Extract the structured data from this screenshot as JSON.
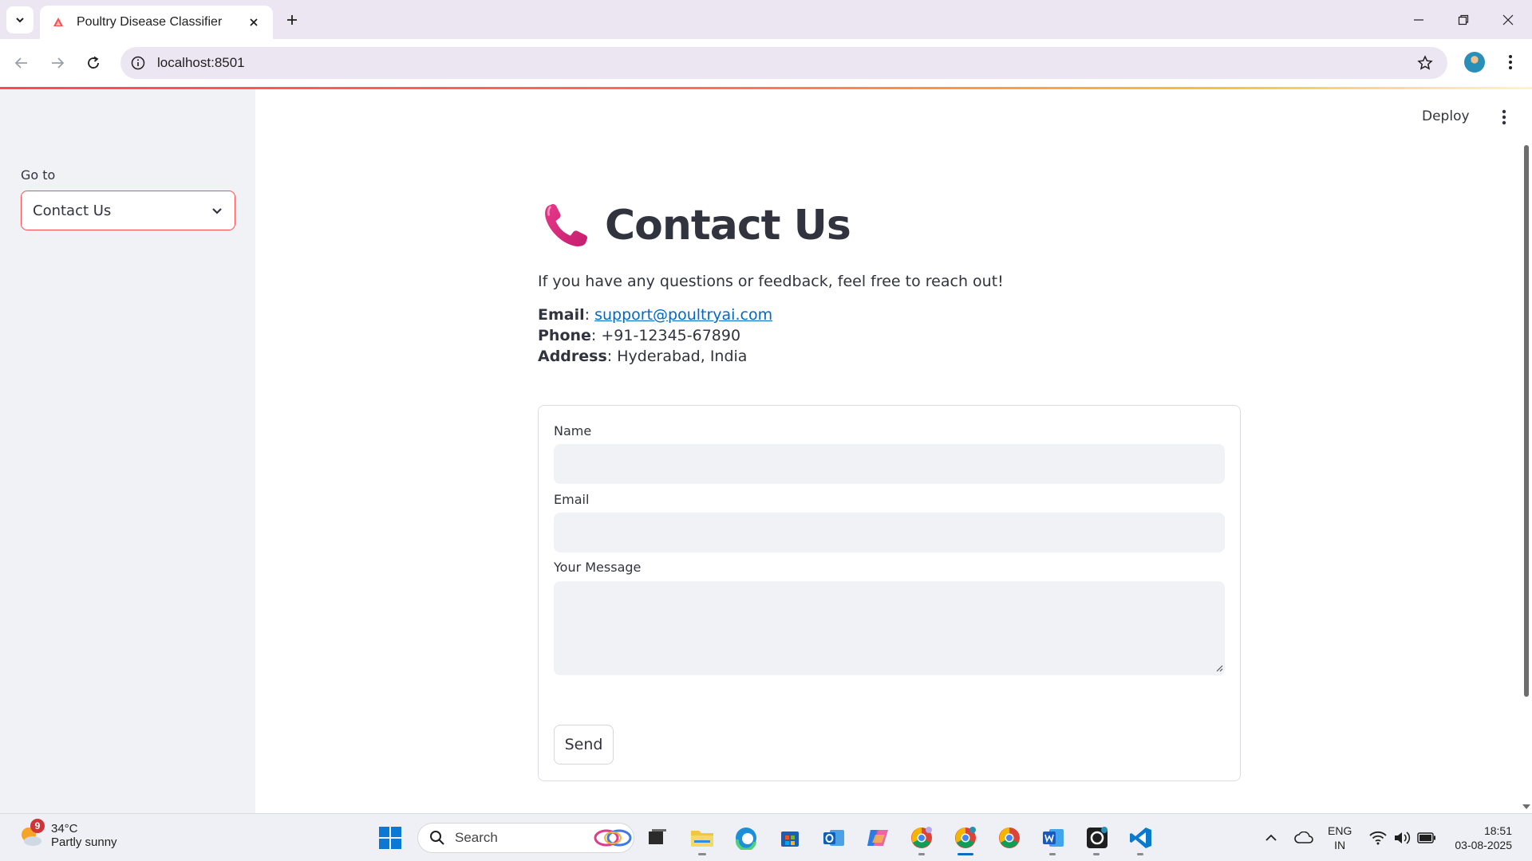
{
  "browser": {
    "tab_title": "Poultry Disease Classifier",
    "url": "localhost:8501"
  },
  "sidebar": {
    "goto_label": "Go to",
    "selected_page": "Contact Us"
  },
  "header": {
    "deploy_label": "Deploy"
  },
  "page": {
    "title": "Contact Us",
    "intro": "If you have any questions or feedback, feel free to reach out!",
    "email_label": "Email",
    "email_value": "support@poultryai.com",
    "phone_label": "Phone",
    "phone_value": "+91-12345-67890",
    "address_label": "Address",
    "address_value": "Hyderabad, India"
  },
  "form": {
    "name_label": "Name",
    "name_value": "",
    "email_label": "Email",
    "email_value": "",
    "message_label": "Your Message",
    "message_value": "",
    "send_label": "Send"
  },
  "taskbar": {
    "weather_temp": "34°C",
    "weather_cond": "Partly sunny",
    "weather_badge": "9",
    "search_placeholder": "Search",
    "lang_line1": "ENG",
    "lang_line2": "IN",
    "time": "18:51",
    "date": "03-08-2025"
  },
  "colors": {
    "accent": "#ff4b4b",
    "link": "#0068c9",
    "sidebar_bg": "#f0f2f6",
    "text": "#31333f"
  }
}
